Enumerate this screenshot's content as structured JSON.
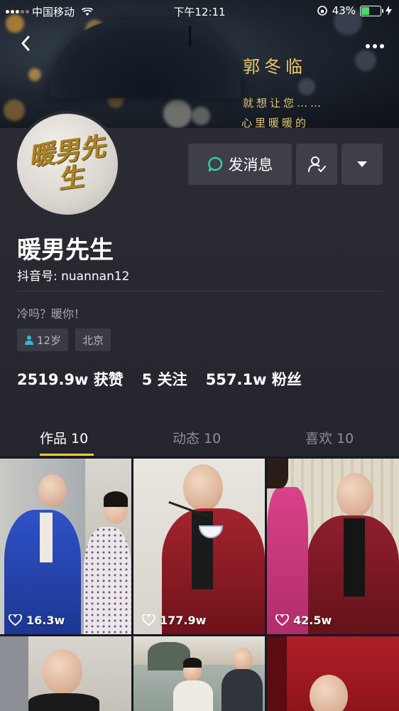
{
  "status_bar": {
    "carrier": "中国移动",
    "time": "下午12:11",
    "battery": "43%",
    "battery_level": 0.43
  },
  "banner": {
    "title": "郭冬临",
    "line1": "就想让您……",
    "line2": "心里暖暖的"
  },
  "nav": {
    "back_icon": "chevron-left-icon",
    "more_icon": "more-dots-icon"
  },
  "profile": {
    "avatar_text": "暖男先生",
    "name": "暖男先生",
    "douyin_id": "抖音号: nuannan12",
    "bio": "冷吗？暖你！",
    "tags": {
      "age": "12岁",
      "city": "北京"
    },
    "stats": {
      "likes": "2519.9w 获赞",
      "following": "5 关注",
      "fans": "557.1w 粉丝"
    }
  },
  "actions": {
    "message_label": "发消息",
    "message_icon": "chat-bubble-icon",
    "follow_icon": "user-check-icon",
    "dropdown_icon": "caret-down-icon"
  },
  "tabs": [
    {
      "label": "作品 10",
      "active": true
    },
    {
      "label": "动态 10",
      "active": false
    },
    {
      "label": "喜欢 10",
      "active": false
    }
  ],
  "videos": [
    {
      "likes": "16.3w"
    },
    {
      "likes": "177.9w"
    },
    {
      "likes": "42.5w"
    }
  ],
  "colors": {
    "background": "#161823",
    "tab_accent": "#facd2d",
    "banner_gold": "#e8c86a",
    "msg_icon_green": "#2fd3a4"
  }
}
